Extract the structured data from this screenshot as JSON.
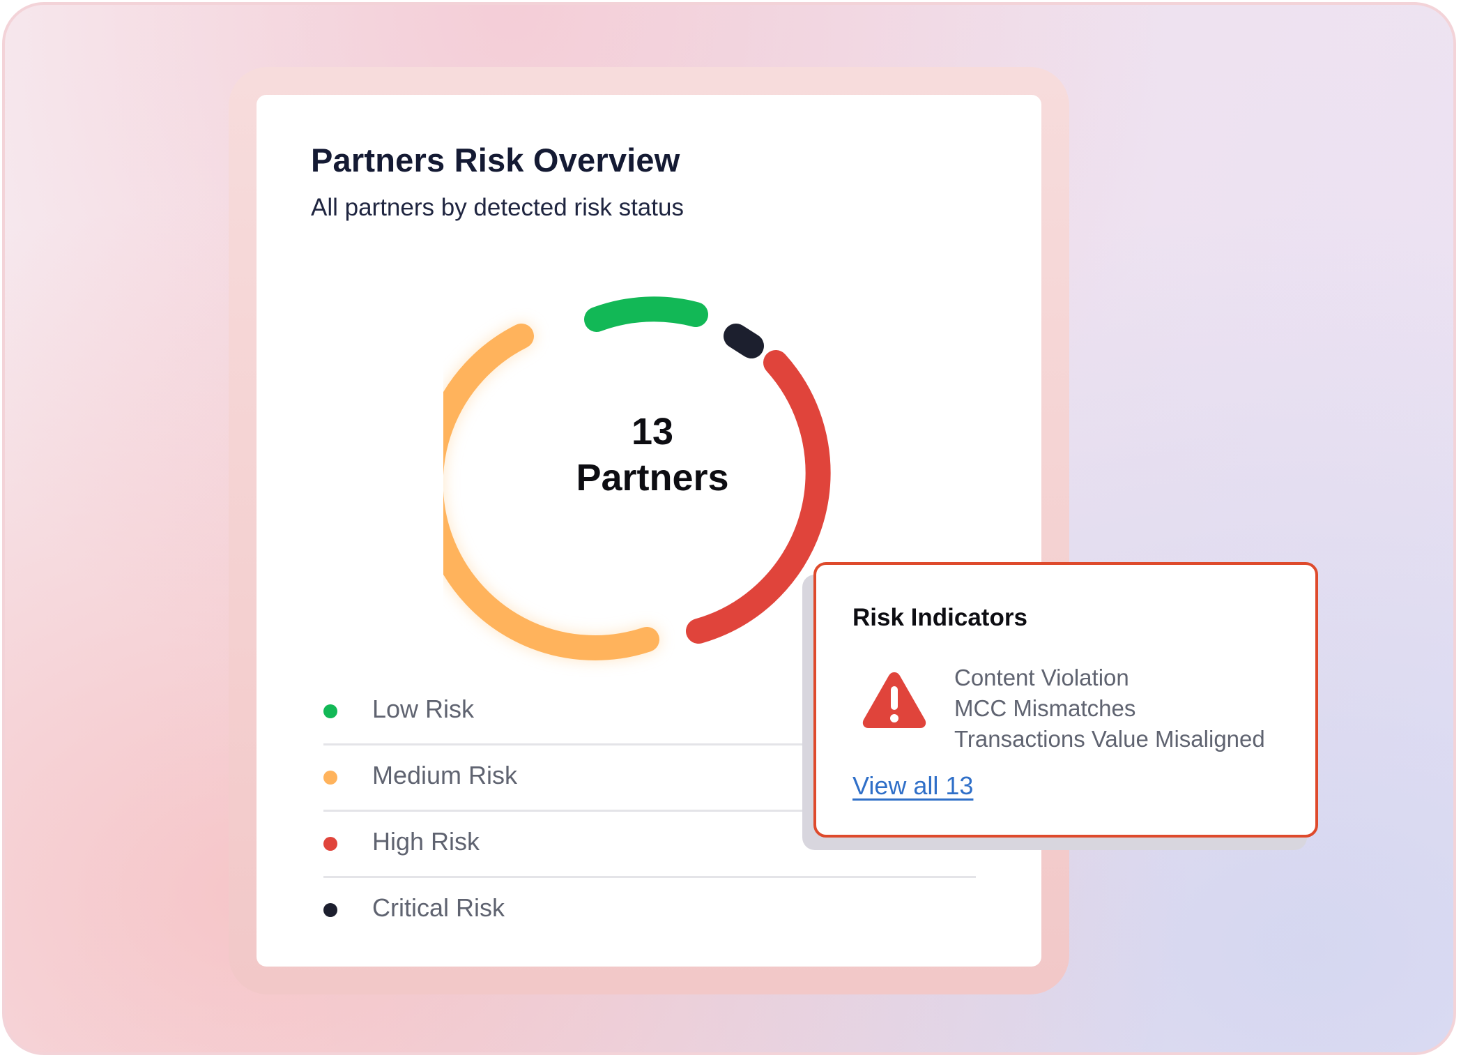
{
  "card": {
    "title": "Partners Risk Overview",
    "subtitle": "All partners by detected risk status",
    "center_count": "13",
    "center_label": "Partners"
  },
  "legend": [
    {
      "label": "Low Risk",
      "color": "#12b856"
    },
    {
      "label": "Medium Risk",
      "color": "#ffb35c"
    },
    {
      "label": "High Risk",
      "color": "#e0443b"
    },
    {
      "label": "Critical Risk",
      "color": "#1c1f2e"
    }
  ],
  "popover": {
    "title": "Risk Indicators",
    "icon": "warning-triangle-icon",
    "indicators": [
      "Content Violation",
      "MCC Mismatches",
      "Transactions Value Misaligned"
    ],
    "link": "View all 13",
    "border_color": "#de4a2c"
  }
}
